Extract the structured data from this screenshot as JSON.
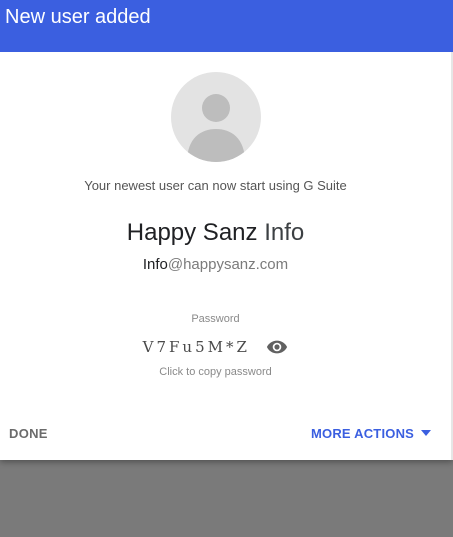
{
  "dialog": {
    "title": "New user added",
    "subtitle": "Your newest user can now start using G Suite"
  },
  "user": {
    "first_name": "Happy Sanz",
    "last_name": "Info",
    "email_local": "Info",
    "email_domain": "@happysanz.com"
  },
  "password": {
    "label": "Password",
    "value": "V7Fu5M*Z",
    "hint": "Click to copy password"
  },
  "actions": {
    "done_label": "DONE",
    "more_label": "MORE ACTIONS"
  },
  "icons": {
    "avatar": "person-avatar-icon",
    "reveal": "eye-icon",
    "menu": "caret-down-icon"
  },
  "colors": {
    "accent": "#3b5fe0",
    "backdrop": "#7a7a7a"
  }
}
